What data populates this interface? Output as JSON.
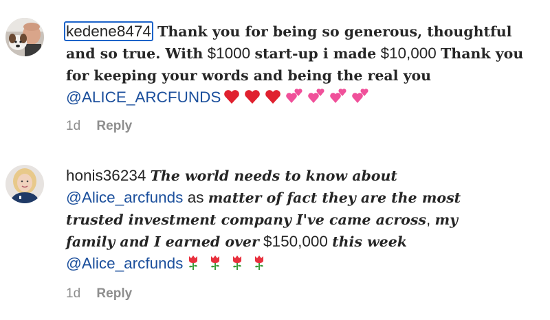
{
  "comments": [
    {
      "username": "kedene8474",
      "avatar_icon": "avatar-man-with-dog",
      "text_part1": "Thank you for being so generous, thoughtful",
      "text_part2": "and so true. With",
      "amount1": "$1000",
      "text_part3": "start-up i made",
      "amount2": "$10,000",
      "text_part4": "Thank you",
      "text_part5": "for keeping your words and being the real you",
      "mention": "@ALICE_ARCFUNDS",
      "emojis": [
        "red-heart",
        "red-heart",
        "red-heart",
        "two-hearts",
        "two-hearts",
        "two-hearts",
        "two-hearts"
      ],
      "time": "1d",
      "reply_label": "Reply"
    },
    {
      "username": "honis36234",
      "avatar_icon": "avatar-blonde-woman",
      "text_part1": "The world needs to know about",
      "mention1": "@Alice_arcfunds",
      "text_part2": "as",
      "text_part3": "matter of fact they are the most",
      "text_part4": "trusted investment company I've came across",
      "text_part5": ",",
      "text_part6": "my",
      "text_part7": "family and I earned over",
      "amount": "$150,000",
      "text_part8": "this week",
      "mention2": "@Alice_arcfunds",
      "emojis": [
        "rose",
        "rose",
        "rose",
        "rose"
      ],
      "time": "1d",
      "reply_label": "Reply"
    }
  ],
  "colors": {
    "text": "#262626",
    "mention": "#1b4f9c",
    "meta": "#8e8e8e",
    "highlight_border": "#1c63c9",
    "heart": "#e0212f",
    "two_hearts": "#f0509a",
    "rose": "#e8303d",
    "stem": "#3a9a3a"
  }
}
